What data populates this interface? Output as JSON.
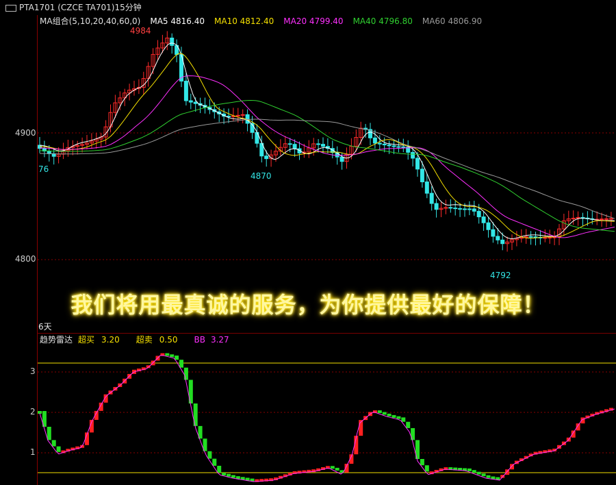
{
  "window": {
    "title": "PTA1701 (CZCE TA701)15分钟"
  },
  "main_legend": {
    "ma_group": "MA组合(5,10,20,40,60,0)",
    "ma5": "MA5 4816.40",
    "ma10": "MA10 4812.40",
    "ma20": "MA20 4799.40",
    "ma40": "MA40 4796.80",
    "ma60": "MA60 4806.90"
  },
  "colors": {
    "ma_group": "#e0e0e0",
    "ma5": "#ffffff",
    "ma10": "#f5e000",
    "ma20": "#ff30ff",
    "ma40": "#30d030",
    "ma60": "#9a9a9a",
    "up": "#ff2a2a",
    "down": "#33e6e6",
    "grid": "#8b0000"
  },
  "y_axis": {
    "label_4900": "4900",
    "label_4800": "4800"
  },
  "annotations": {
    "high": "4984",
    "left_edge": "76",
    "low1": "4870",
    "low2": "4792"
  },
  "promo_text": "我们将用最真诚的服务，为你提供最好的保障！",
  "period_label": "6天",
  "sub_legend": {
    "name": "趋势雷达",
    "overbuy_label": "超买",
    "overbuy_value": "3.20",
    "oversell_label": "超卖",
    "oversell_value": "0.50",
    "bb_label": "BB",
    "bb_value": "3.27"
  },
  "sub_y_axis": {
    "label_3": "3",
    "label_2": "2",
    "label_1": "1"
  }
}
